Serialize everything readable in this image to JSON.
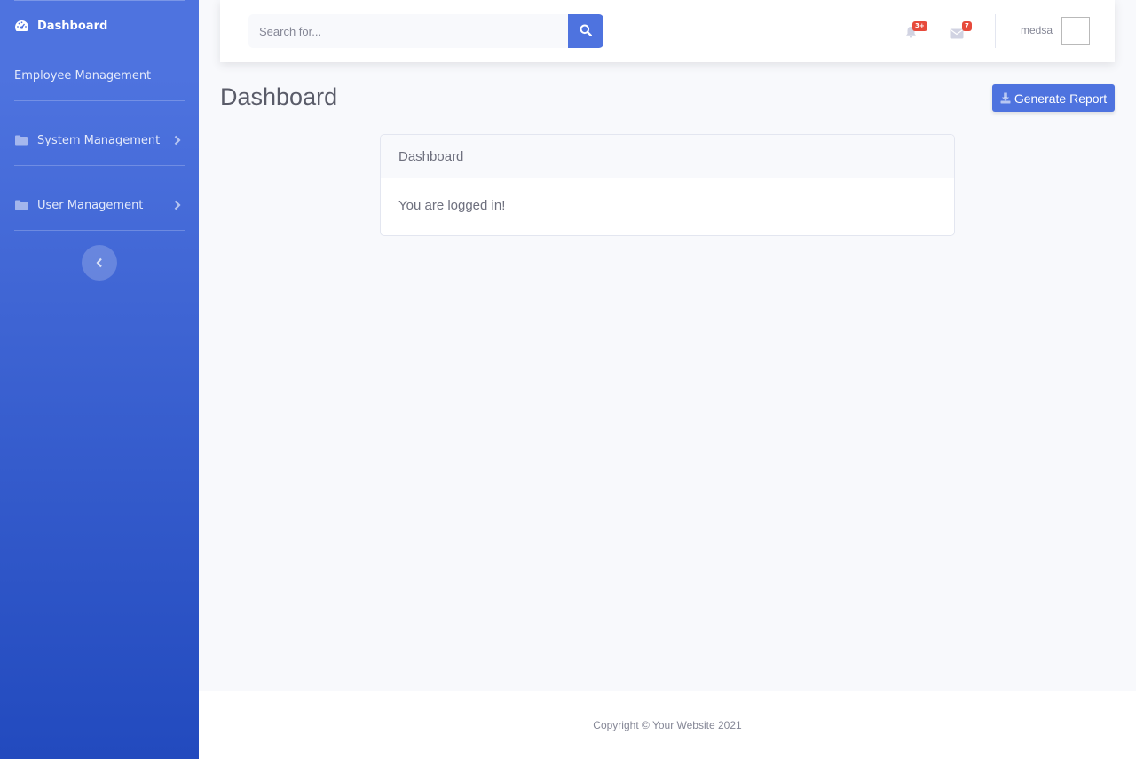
{
  "sidebar": {
    "items": [
      {
        "label": "Dashboard",
        "icon": "tachometer-icon",
        "active": true
      },
      {
        "label": "Employee Management"
      },
      {
        "label": "System Management",
        "icon": "folder-icon",
        "has_submenu": true
      },
      {
        "label": "User Management",
        "icon": "folder-icon",
        "has_submenu": true
      }
    ]
  },
  "topbar": {
    "search_placeholder": "Search for...",
    "alerts_badge": "3+",
    "messages_badge": "7",
    "username": "medsa"
  },
  "main": {
    "page_title": "Dashboard",
    "generate_report_label": "Generate Report",
    "card": {
      "header": "Dashboard",
      "body": "You are logged in!"
    }
  },
  "footer": {
    "copyright": "Copyright © Your Website 2021"
  },
  "colors": {
    "primary": "#4e73df",
    "primary_dark": "#224abe",
    "badge_danger": "#e74a3b",
    "background": "#f8f9fc"
  }
}
